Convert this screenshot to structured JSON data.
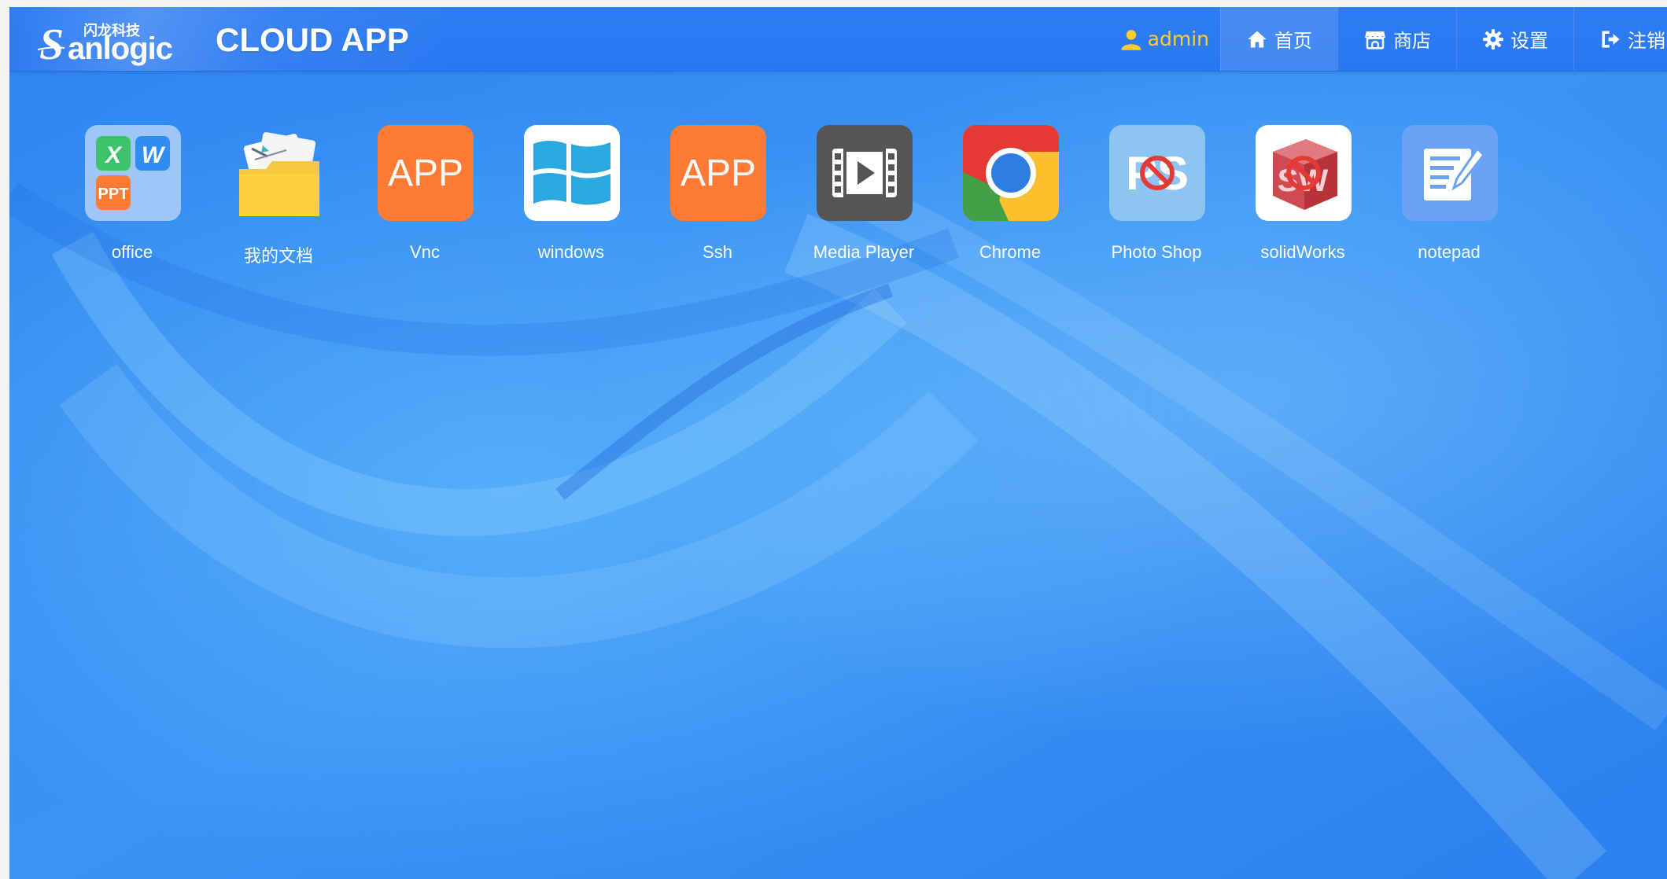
{
  "header": {
    "logo_cn": "闪龙科技",
    "logo_brand": "Sanlogic",
    "title": "CLOUD APP"
  },
  "nav": {
    "user": {
      "label": "admin",
      "icon": "user-icon"
    },
    "items": [
      {
        "label": "首页",
        "icon": "home-icon",
        "active": true
      },
      {
        "label": "商店",
        "icon": "store-icon",
        "active": false
      },
      {
        "label": "设置",
        "icon": "gear-icon",
        "active": false
      },
      {
        "label": "注销",
        "icon": "logout-icon",
        "active": false
      }
    ]
  },
  "apps": [
    {
      "label": "office",
      "icon": "office-icon",
      "tiles": [
        "X",
        "W",
        "PPT"
      ]
    },
    {
      "label": "我的文档",
      "icon": "folder-icon"
    },
    {
      "label": "Vnc",
      "icon": "app-icon",
      "badge": "APP"
    },
    {
      "label": "windows",
      "icon": "windows-icon"
    },
    {
      "label": "Ssh",
      "icon": "app-icon",
      "badge": "APP"
    },
    {
      "label": "Media Player",
      "icon": "media-player-icon"
    },
    {
      "label": "Chrome",
      "icon": "chrome-icon"
    },
    {
      "label": "Photo Shop",
      "icon": "photoshop-disabled-icon",
      "badge": "PS"
    },
    {
      "label": "solidWorks",
      "icon": "solidworks-disabled-icon",
      "badge": "SW"
    },
    {
      "label": "notepad",
      "icon": "notepad-icon"
    }
  ],
  "colors": {
    "background": "#2d86f2",
    "user_accent": "#ffcc2e",
    "app_orange": "#ff7a35",
    "chrome_red": "#e53935",
    "chrome_yellow": "#fbc02d",
    "chrome_green": "#43a047",
    "chrome_blue": "#2f7de1"
  }
}
